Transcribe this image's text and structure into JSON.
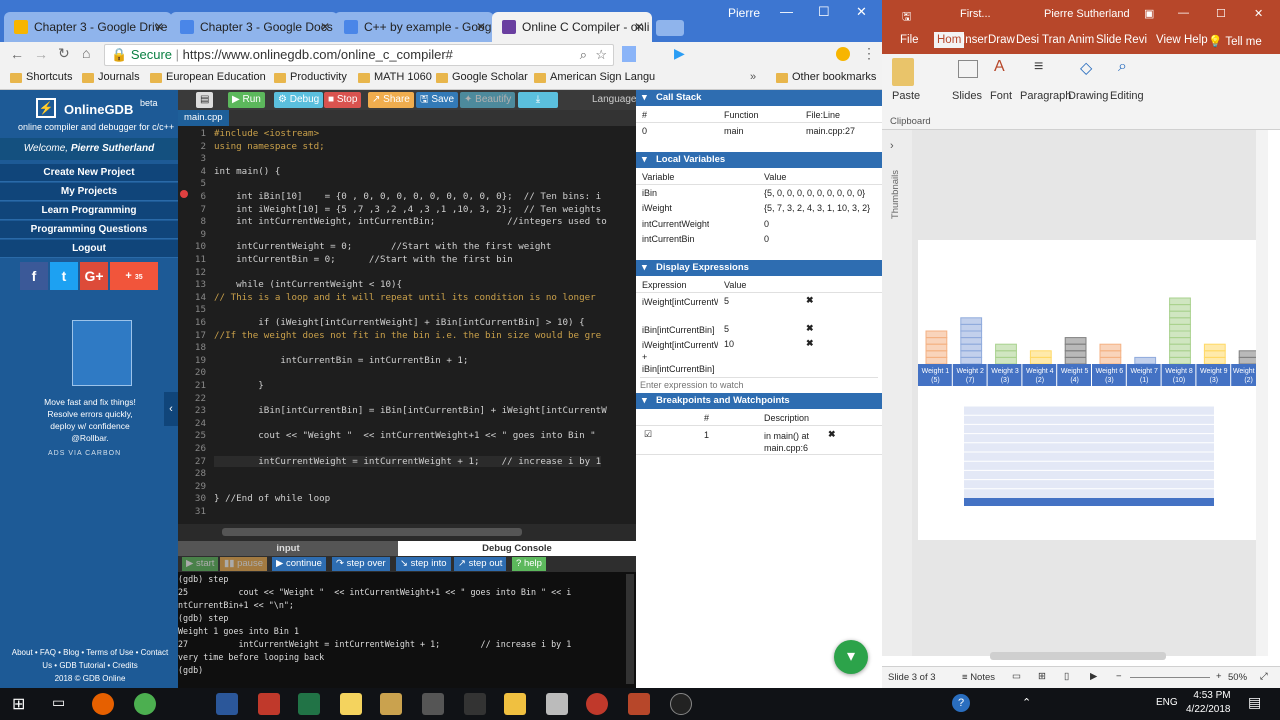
{
  "chrome": {
    "tabs": [
      {
        "label": "Chapter 3 - Google Drive",
        "color": "#f7b500"
      },
      {
        "label": "Chapter 3 - Google Docs",
        "color": "#4a86e8"
      },
      {
        "label": "C++ by example - Goog",
        "color": "#4a86e8"
      },
      {
        "label": "Online C Compiler - onli",
        "color": "#6a3fa0"
      }
    ],
    "profile": "Pierre",
    "secure_label": "Secure",
    "url": "https://www.onlinegdb.com/online_c_compiler#",
    "bookmarks": [
      "Shortcuts",
      "Journals",
      "European Education",
      "Productivity",
      "MATH 1060",
      "Google Scholar",
      "American Sign Langu",
      "Other bookmarks"
    ]
  },
  "gdb_sidebar": {
    "brand": "OnlineGDB",
    "brand_sup": "beta",
    "tagline": "online compiler and debugger for c/c++",
    "welcome": "Welcome,",
    "user": "Pierre Sutherland",
    "menu": [
      "Create New Project",
      "My Projects",
      "Learn Programming",
      "Programming Questions",
      "Logout"
    ],
    "social_count": "35",
    "ad_text": "Move fast and fix things! Resolve errors quickly, deploy w/ confidence @Rollbar.",
    "ad_via": "ADS VIA CARBON",
    "footer": [
      "About • FAQ • Blog • Terms of Use • Contact",
      "Us • GDB Tutorial • Credits",
      "2018 © GDB Online"
    ]
  },
  "editor": {
    "buttons": [
      "Run",
      "Debug",
      "Stop",
      "Share",
      "Save",
      "Beautify"
    ],
    "language_label": "Language",
    "file_tab": "main.cpp",
    "lines": [
      {
        "n": "1",
        "t": "#include <iostream>"
      },
      {
        "n": "2",
        "t": "using namespace std;"
      },
      {
        "n": "3",
        "t": ""
      },
      {
        "n": "4",
        "t": "int main() {"
      },
      {
        "n": "5",
        "t": ""
      },
      {
        "n": "6",
        "t": "    int iBin[10]    = {0 , 0, 0, 0, 0, 0, 0, 0, 0, 0};  // Ten bins: i"
      },
      {
        "n": "7",
        "t": "    int iWeight[10] = {5 ,7 ,3 ,2 ,4 ,3 ,1 ,10, 3, 2};  // Ten weights"
      },
      {
        "n": "8",
        "t": "    int intCurrentWeight, intCurrentBin;             //integers used to"
      },
      {
        "n": "9",
        "t": ""
      },
      {
        "n": "10",
        "t": "    intCurrentWeight = 0;       //Start with the first weight"
      },
      {
        "n": "11",
        "t": "    intCurrentBin = 0;      //Start with the first bin"
      },
      {
        "n": "12",
        "t": ""
      },
      {
        "n": "13",
        "t": "    while (intCurrentWeight < 10){"
      },
      {
        "n": "14",
        "t": "// This is a loop and it will repeat until its condition is no longer"
      },
      {
        "n": "15",
        "t": ""
      },
      {
        "n": "16",
        "t": "        if (iWeight[intCurrentWeight] + iBin[intCurrentBin] > 10) {"
      },
      {
        "n": "17",
        "t": "//If the weight does not fit in the bin i.e. the bin size would be gre"
      },
      {
        "n": "18",
        "t": ""
      },
      {
        "n": "19",
        "t": "            intCurrentBin = intCurrentBin + 1;"
      },
      {
        "n": "20",
        "t": ""
      },
      {
        "n": "21",
        "t": "        }"
      },
      {
        "n": "22",
        "t": ""
      },
      {
        "n": "23",
        "t": "        iBin[intCurrentBin] = iBin[intCurrentBin] + iWeight[intCurrentW"
      },
      {
        "n": "24",
        "t": ""
      },
      {
        "n": "25",
        "t": "        cout << \"Weight \"  << intCurrentWeight+1 << \" goes into Bin \""
      },
      {
        "n": "26",
        "t": ""
      },
      {
        "n": "27",
        "t": "        intCurrentWeight = intCurrentWeight + 1;    // increase i by 1"
      },
      {
        "n": "28",
        "t": ""
      },
      {
        "n": "29",
        "t": ""
      },
      {
        "n": "30",
        "t": "} //End of while loop"
      },
      {
        "n": "31",
        "t": ""
      }
    ]
  },
  "debug": {
    "tabs": [
      "input",
      "Debug Console"
    ],
    "buttons": [
      "start",
      "pause",
      "continue",
      "step over",
      "step into",
      "step out",
      "help"
    ],
    "console": [
      "(gdb) step",
      "25          cout << \"Weight \"  << intCurrentWeight+1 << \" goes into Bin \" << i",
      "ntCurrentBin+1 << \"\\n\";",
      "(gdb) step",
      "Weight 1 goes into Bin 1",
      "27          intCurrentWeight = intCurrentWeight + 1;        // increase i by 1",
      "very time before looping back",
      "(gdb) "
    ]
  },
  "panels": {
    "call_stack": {
      "title": "Call Stack",
      "headers": [
        "#",
        "Function",
        "File:Line"
      ],
      "rows": [
        [
          "0",
          "main",
          "main.cpp:27"
        ]
      ]
    },
    "locals": {
      "title": "Local Variables",
      "headers": [
        "Variable",
        "Value"
      ],
      "rows": [
        [
          "iBin",
          "{5, 0, 0, 0, 0, 0, 0, 0, 0, 0}"
        ],
        [
          "iWeight",
          "{5, 7, 3, 2, 4, 3, 1, 10, 3, 2}"
        ],
        [
          "intCurrentWeight",
          "0"
        ],
        [
          "intCurrentBin",
          "0"
        ]
      ]
    },
    "display": {
      "title": "Display Expressions",
      "headers": [
        "Expression",
        "Value"
      ],
      "rows": [
        [
          "iWeight[intCurrentWeight]",
          "5"
        ],
        [
          "iBin[intCurrentBin]",
          "5"
        ],
        [
          "iWeight[intCurrentWeight] + iBin[intCurrentBin]",
          "10"
        ]
      ],
      "placeholder": "Enter expression to watch"
    },
    "breakpoints": {
      "title": "Breakpoints and Watchpoints",
      "headers": [
        "#",
        "Description"
      ],
      "rows": [
        [
          "1",
          "in main() at main.cpp:6"
        ]
      ]
    }
  },
  "ppt": {
    "title": "First...",
    "user": "Pierre Sutherland",
    "tabs": [
      "File",
      "Hom",
      "Inser",
      "Draw",
      "Desi",
      "Tran",
      "Anim",
      "Slide",
      "Revi",
      "View",
      "Help",
      "Tell me"
    ],
    "groups": [
      "Paste",
      "Slides",
      "Font",
      "Paragraph",
      "Drawing",
      "Editing"
    ],
    "clipboard": "Clipboard",
    "thumbnails": "Thumbnails",
    "weights": [
      "Weight 1 (5)",
      "Weight 2 (7)",
      "Weight 3 (3)",
      "Weight 4 (2)",
      "Weight 5 (4)",
      "Weight 6 (3)",
      "Weight 7 (1)",
      "Weight 8 (10)",
      "Weight 9 (3)",
      "Weight 10 (2)"
    ],
    "weight_values": [
      5,
      7,
      3,
      2,
      4,
      3,
      1,
      10,
      3,
      2
    ],
    "weight_colors": [
      "#f4b183",
      "#8faadc",
      "#a9d18e",
      "#ffd966",
      "#7f7f7f",
      "#f4b183",
      "#8faadc",
      "#a9d18e",
      "#ffd966",
      "#7f7f7f"
    ],
    "status_slide": "Slide 3 of 3",
    "notes": "Notes",
    "zoom": "50%"
  },
  "taskbar": {
    "lang": "ENG",
    "time": "4:53 PM",
    "date": "4/22/2018"
  }
}
